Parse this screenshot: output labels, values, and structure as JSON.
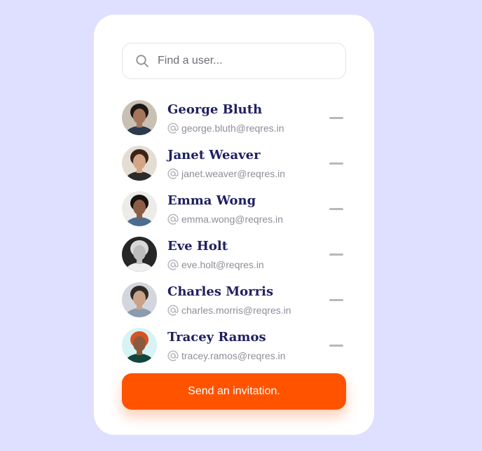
{
  "search": {
    "placeholder": "Find a user...",
    "value": "",
    "icon": "search-icon"
  },
  "users": [
    {
      "name": "George Bluth",
      "email": "george.bluth@reqres.in",
      "avatar_bg": "#c9c0b4",
      "hair": "#1e1814",
      "skin": "#a5765b",
      "shirt": "#2c3a4c"
    },
    {
      "name": "Janet Weaver",
      "email": "janet.weaver@reqres.in",
      "avatar_bg": "#e4ddd3",
      "hair": "#3a2418",
      "skin": "#d3a585",
      "shirt": "#2b2b2b"
    },
    {
      "name": "Emma Wong",
      "email": "emma.wong@reqres.in",
      "avatar_bg": "#ecebe8",
      "hair": "#151210",
      "skin": "#8e5d45",
      "shirt": "#4b6d8f"
    },
    {
      "name": "Eve Holt",
      "email": "eve.holt@reqres.in",
      "avatar_bg": "#262626",
      "hair": "#d8d8d8",
      "skin": "#bdbdbd",
      "shirt": "#eeeeee"
    },
    {
      "name": "Charles Morris",
      "email": "charles.morris@reqres.in",
      "avatar_bg": "#d3d6dc",
      "hair": "#2f2a28",
      "skin": "#caa287",
      "shirt": "#8a9cae"
    },
    {
      "name": "Tracey Ramos",
      "email": "tracey.ramos@reqres.in",
      "avatar_bg": "#d8f3f5",
      "hair": "#d65423",
      "skin": "#8b5a3e",
      "shirt": "#12463f"
    }
  ],
  "invite_label": "Send an invitation.",
  "colors": {
    "background": "#dfe0ff",
    "card": "#ffffff",
    "name": "#1f2060",
    "email": "#8e8e98",
    "accent": "#ff5300",
    "remove": "#b7b7bd"
  }
}
